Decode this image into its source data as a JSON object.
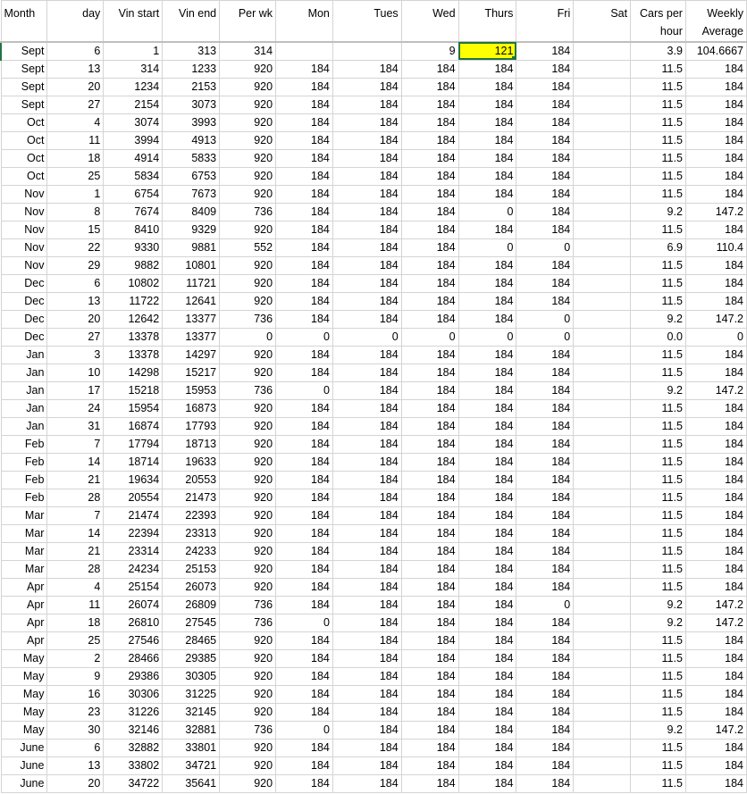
{
  "columns": [
    "Month",
    "day",
    "Vin start",
    "Vin end",
    "Per wk",
    "Mon",
    "Tues",
    "Wed",
    "Thurs",
    "Fri",
    "Sat",
    "Cars per hour",
    "Weekly Average"
  ],
  "rows": [
    [
      "Sept",
      "6",
      "1",
      "313",
      "314",
      "",
      "",
      "9",
      "121",
      "184",
      "",
      "3.9",
      "104.6667"
    ],
    [
      "Sept",
      "13",
      "314",
      "1233",
      "920",
      "184",
      "184",
      "184",
      "184",
      "184",
      "",
      "11.5",
      "184"
    ],
    [
      "Sept",
      "20",
      "1234",
      "2153",
      "920",
      "184",
      "184",
      "184",
      "184",
      "184",
      "",
      "11.5",
      "184"
    ],
    [
      "Sept",
      "27",
      "2154",
      "3073",
      "920",
      "184",
      "184",
      "184",
      "184",
      "184",
      "",
      "11.5",
      "184"
    ],
    [
      "Oct",
      "4",
      "3074",
      "3993",
      "920",
      "184",
      "184",
      "184",
      "184",
      "184",
      "",
      "11.5",
      "184"
    ],
    [
      "Oct",
      "11",
      "3994",
      "4913",
      "920",
      "184",
      "184",
      "184",
      "184",
      "184",
      "",
      "11.5",
      "184"
    ],
    [
      "Oct",
      "18",
      "4914",
      "5833",
      "920",
      "184",
      "184",
      "184",
      "184",
      "184",
      "",
      "11.5",
      "184"
    ],
    [
      "Oct",
      "25",
      "5834",
      "6753",
      "920",
      "184",
      "184",
      "184",
      "184",
      "184",
      "",
      "11.5",
      "184"
    ],
    [
      "Nov",
      "1",
      "6754",
      "7673",
      "920",
      "184",
      "184",
      "184",
      "184",
      "184",
      "",
      "11.5",
      "184"
    ],
    [
      "Nov",
      "8",
      "7674",
      "8409",
      "736",
      "184",
      "184",
      "184",
      "0",
      "184",
      "",
      "9.2",
      "147.2"
    ],
    [
      "Nov",
      "15",
      "8410",
      "9329",
      "920",
      "184",
      "184",
      "184",
      "184",
      "184",
      "",
      "11.5",
      "184"
    ],
    [
      "Nov",
      "22",
      "9330",
      "9881",
      "552",
      "184",
      "184",
      "184",
      "0",
      "0",
      "",
      "6.9",
      "110.4"
    ],
    [
      "Nov",
      "29",
      "9882",
      "10801",
      "920",
      "184",
      "184",
      "184",
      "184",
      "184",
      "",
      "11.5",
      "184"
    ],
    [
      "Dec",
      "6",
      "10802",
      "11721",
      "920",
      "184",
      "184",
      "184",
      "184",
      "184",
      "",
      "11.5",
      "184"
    ],
    [
      "Dec",
      "13",
      "11722",
      "12641",
      "920",
      "184",
      "184",
      "184",
      "184",
      "184",
      "",
      "11.5",
      "184"
    ],
    [
      "Dec",
      "20",
      "12642",
      "13377",
      "736",
      "184",
      "184",
      "184",
      "184",
      "0",
      "",
      "9.2",
      "147.2"
    ],
    [
      "Dec",
      "27",
      "13378",
      "13377",
      "0",
      "0",
      "0",
      "0",
      "0",
      "0",
      "",
      "0.0",
      "0"
    ],
    [
      "Jan",
      "3",
      "13378",
      "14297",
      "920",
      "184",
      "184",
      "184",
      "184",
      "184",
      "",
      "11.5",
      "184"
    ],
    [
      "Jan",
      "10",
      "14298",
      "15217",
      "920",
      "184",
      "184",
      "184",
      "184",
      "184",
      "",
      "11.5",
      "184"
    ],
    [
      "Jan",
      "17",
      "15218",
      "15953",
      "736",
      "0",
      "184",
      "184",
      "184",
      "184",
      "",
      "9.2",
      "147.2"
    ],
    [
      "Jan",
      "24",
      "15954",
      "16873",
      "920",
      "184",
      "184",
      "184",
      "184",
      "184",
      "",
      "11.5",
      "184"
    ],
    [
      "Jan",
      "31",
      "16874",
      "17793",
      "920",
      "184",
      "184",
      "184",
      "184",
      "184",
      "",
      "11.5",
      "184"
    ],
    [
      "Feb",
      "7",
      "17794",
      "18713",
      "920",
      "184",
      "184",
      "184",
      "184",
      "184",
      "",
      "11.5",
      "184"
    ],
    [
      "Feb",
      "14",
      "18714",
      "19633",
      "920",
      "184",
      "184",
      "184",
      "184",
      "184",
      "",
      "11.5",
      "184"
    ],
    [
      "Feb",
      "21",
      "19634",
      "20553",
      "920",
      "184",
      "184",
      "184",
      "184",
      "184",
      "",
      "11.5",
      "184"
    ],
    [
      "Feb",
      "28",
      "20554",
      "21473",
      "920",
      "184",
      "184",
      "184",
      "184",
      "184",
      "",
      "11.5",
      "184"
    ],
    [
      "Mar",
      "7",
      "21474",
      "22393",
      "920",
      "184",
      "184",
      "184",
      "184",
      "184",
      "",
      "11.5",
      "184"
    ],
    [
      "Mar",
      "14",
      "22394",
      "23313",
      "920",
      "184",
      "184",
      "184",
      "184",
      "184",
      "",
      "11.5",
      "184"
    ],
    [
      "Mar",
      "21",
      "23314",
      "24233",
      "920",
      "184",
      "184",
      "184",
      "184",
      "184",
      "",
      "11.5",
      "184"
    ],
    [
      "Mar",
      "28",
      "24234",
      "25153",
      "920",
      "184",
      "184",
      "184",
      "184",
      "184",
      "",
      "11.5",
      "184"
    ],
    [
      "Apr",
      "4",
      "25154",
      "26073",
      "920",
      "184",
      "184",
      "184",
      "184",
      "184",
      "",
      "11.5",
      "184"
    ],
    [
      "Apr",
      "11",
      "26074",
      "26809",
      "736",
      "184",
      "184",
      "184",
      "184",
      "0",
      "",
      "9.2",
      "147.2"
    ],
    [
      "Apr",
      "18",
      "26810",
      "27545",
      "736",
      "0",
      "184",
      "184",
      "184",
      "184",
      "",
      "9.2",
      "147.2"
    ],
    [
      "Apr",
      "25",
      "27546",
      "28465",
      "920",
      "184",
      "184",
      "184",
      "184",
      "184",
      "",
      "11.5",
      "184"
    ],
    [
      "May",
      "2",
      "28466",
      "29385",
      "920",
      "184",
      "184",
      "184",
      "184",
      "184",
      "",
      "11.5",
      "184"
    ],
    [
      "May",
      "9",
      "29386",
      "30305",
      "920",
      "184",
      "184",
      "184",
      "184",
      "184",
      "",
      "11.5",
      "184"
    ],
    [
      "May",
      "16",
      "30306",
      "31225",
      "920",
      "184",
      "184",
      "184",
      "184",
      "184",
      "",
      "11.5",
      "184"
    ],
    [
      "May",
      "23",
      "31226",
      "32145",
      "920",
      "184",
      "184",
      "184",
      "184",
      "184",
      "",
      "11.5",
      "184"
    ],
    [
      "May",
      "30",
      "32146",
      "32881",
      "736",
      "0",
      "184",
      "184",
      "184",
      "184",
      "",
      "9.2",
      "147.2"
    ],
    [
      "June",
      "6",
      "32882",
      "33801",
      "920",
      "184",
      "184",
      "184",
      "184",
      "184",
      "",
      "11.5",
      "184"
    ],
    [
      "June",
      "13",
      "33802",
      "34721",
      "920",
      "184",
      "184",
      "184",
      "184",
      "184",
      "",
      "11.5",
      "184"
    ],
    [
      "June",
      "20",
      "34722",
      "35641",
      "920",
      "184",
      "184",
      "184",
      "184",
      "184",
      "",
      "11.5",
      "184"
    ]
  ],
  "selected_cell": {
    "row": 0,
    "col": 8
  },
  "colors": {
    "highlight": "#ffff00",
    "selection_border": "#217346",
    "gridline": "#d4d4d4"
  }
}
